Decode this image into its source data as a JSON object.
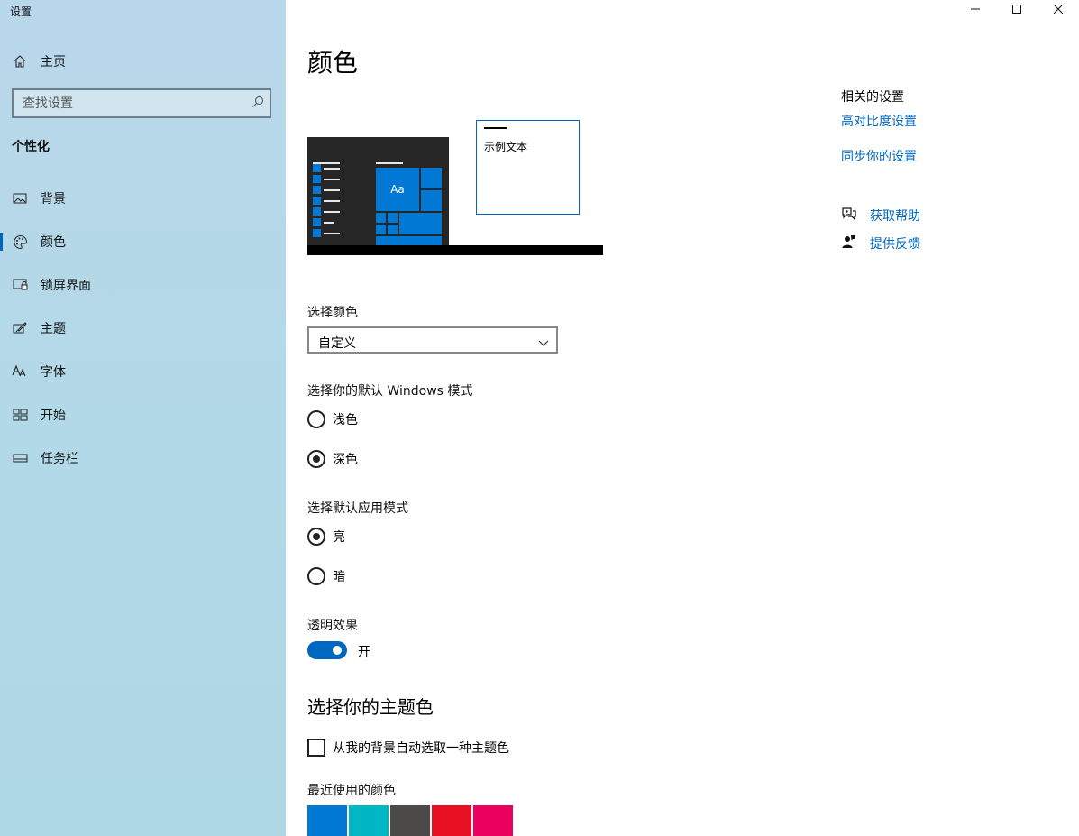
{
  "window": {
    "title": "设置"
  },
  "sidebar": {
    "home_label": "主页",
    "search_placeholder": "查找设置",
    "section_title": "个性化",
    "items": [
      {
        "label": "背景",
        "icon": "image-icon"
      },
      {
        "label": "颜色",
        "icon": "palette-icon",
        "active": true
      },
      {
        "label": "锁屏界面",
        "icon": "lock-screen-icon"
      },
      {
        "label": "主题",
        "icon": "theme-brush-icon"
      },
      {
        "label": "字体",
        "icon": "font-icon"
      },
      {
        "label": "开始",
        "icon": "start-icon"
      },
      {
        "label": "任务栏",
        "icon": "taskbar-icon"
      }
    ]
  },
  "main": {
    "title": "颜色",
    "preview": {
      "sample_text": "示例文本",
      "tile_text": "Aa"
    },
    "choose_color": {
      "label": "选择颜色",
      "value": "自定义"
    },
    "windows_mode": {
      "label": "选择你的默认 Windows 模式",
      "options": [
        "浅色",
        "深色"
      ],
      "selected": "深色"
    },
    "app_mode": {
      "label": "选择默认应用模式",
      "options": [
        "亮",
        "暗"
      ],
      "selected": "亮"
    },
    "transparency": {
      "label": "透明效果",
      "state": "开",
      "on": true
    },
    "accent": {
      "heading": "选择你的主题色",
      "auto_pick_label": "从我的背景自动选取一种主题色",
      "auto_pick_checked": false,
      "recent_label": "最近使用的颜色",
      "recent_colors": [
        "#0078d4",
        "#00b7c3",
        "#4c4a48",
        "#e81123",
        "#ea005e"
      ]
    }
  },
  "related": {
    "heading": "相关的设置",
    "links": [
      "高对比度设置",
      "同步你的设置"
    ],
    "get_help": "获取帮助",
    "feedback": "提供反馈"
  },
  "colors": {
    "accent": "#0067c0",
    "tile_blue": "#0078d4"
  }
}
